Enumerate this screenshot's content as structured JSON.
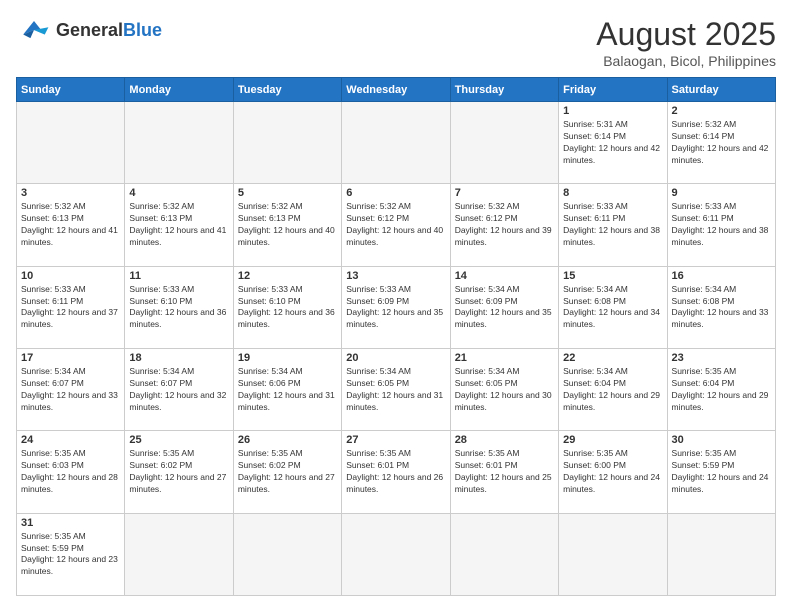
{
  "header": {
    "logo_general": "General",
    "logo_blue": "Blue",
    "month_year": "August 2025",
    "location": "Balaogan, Bicol, Philippines"
  },
  "days_of_week": [
    "Sunday",
    "Monday",
    "Tuesday",
    "Wednesday",
    "Thursday",
    "Friday",
    "Saturday"
  ],
  "weeks": [
    [
      {
        "day": "",
        "empty": true
      },
      {
        "day": "",
        "empty": true
      },
      {
        "day": "",
        "empty": true
      },
      {
        "day": "",
        "empty": true
      },
      {
        "day": "",
        "empty": true
      },
      {
        "day": "1",
        "sunrise": "5:31 AM",
        "sunset": "6:14 PM",
        "daylight": "12 hours and 42 minutes."
      },
      {
        "day": "2",
        "sunrise": "5:32 AM",
        "sunset": "6:14 PM",
        "daylight": "12 hours and 42 minutes."
      }
    ],
    [
      {
        "day": "3",
        "sunrise": "5:32 AM",
        "sunset": "6:13 PM",
        "daylight": "12 hours and 41 minutes."
      },
      {
        "day": "4",
        "sunrise": "5:32 AM",
        "sunset": "6:13 PM",
        "daylight": "12 hours and 41 minutes."
      },
      {
        "day": "5",
        "sunrise": "5:32 AM",
        "sunset": "6:13 PM",
        "daylight": "12 hours and 40 minutes."
      },
      {
        "day": "6",
        "sunrise": "5:32 AM",
        "sunset": "6:12 PM",
        "daylight": "12 hours and 40 minutes."
      },
      {
        "day": "7",
        "sunrise": "5:32 AM",
        "sunset": "6:12 PM",
        "daylight": "12 hours and 39 minutes."
      },
      {
        "day": "8",
        "sunrise": "5:33 AM",
        "sunset": "6:11 PM",
        "daylight": "12 hours and 38 minutes."
      },
      {
        "day": "9",
        "sunrise": "5:33 AM",
        "sunset": "6:11 PM",
        "daylight": "12 hours and 38 minutes."
      }
    ],
    [
      {
        "day": "10",
        "sunrise": "5:33 AM",
        "sunset": "6:11 PM",
        "daylight": "12 hours and 37 minutes."
      },
      {
        "day": "11",
        "sunrise": "5:33 AM",
        "sunset": "6:10 PM",
        "daylight": "12 hours and 36 minutes."
      },
      {
        "day": "12",
        "sunrise": "5:33 AM",
        "sunset": "6:10 PM",
        "daylight": "12 hours and 36 minutes."
      },
      {
        "day": "13",
        "sunrise": "5:33 AM",
        "sunset": "6:09 PM",
        "daylight": "12 hours and 35 minutes."
      },
      {
        "day": "14",
        "sunrise": "5:34 AM",
        "sunset": "6:09 PM",
        "daylight": "12 hours and 35 minutes."
      },
      {
        "day": "15",
        "sunrise": "5:34 AM",
        "sunset": "6:08 PM",
        "daylight": "12 hours and 34 minutes."
      },
      {
        "day": "16",
        "sunrise": "5:34 AM",
        "sunset": "6:08 PM",
        "daylight": "12 hours and 33 minutes."
      }
    ],
    [
      {
        "day": "17",
        "sunrise": "5:34 AM",
        "sunset": "6:07 PM",
        "daylight": "12 hours and 33 minutes."
      },
      {
        "day": "18",
        "sunrise": "5:34 AM",
        "sunset": "6:07 PM",
        "daylight": "12 hours and 32 minutes."
      },
      {
        "day": "19",
        "sunrise": "5:34 AM",
        "sunset": "6:06 PM",
        "daylight": "12 hours and 31 minutes."
      },
      {
        "day": "20",
        "sunrise": "5:34 AM",
        "sunset": "6:05 PM",
        "daylight": "12 hours and 31 minutes."
      },
      {
        "day": "21",
        "sunrise": "5:34 AM",
        "sunset": "6:05 PM",
        "daylight": "12 hours and 30 minutes."
      },
      {
        "day": "22",
        "sunrise": "5:34 AM",
        "sunset": "6:04 PM",
        "daylight": "12 hours and 29 minutes."
      },
      {
        "day": "23",
        "sunrise": "5:35 AM",
        "sunset": "6:04 PM",
        "daylight": "12 hours and 29 minutes."
      }
    ],
    [
      {
        "day": "24",
        "sunrise": "5:35 AM",
        "sunset": "6:03 PM",
        "daylight": "12 hours and 28 minutes."
      },
      {
        "day": "25",
        "sunrise": "5:35 AM",
        "sunset": "6:02 PM",
        "daylight": "12 hours and 27 minutes."
      },
      {
        "day": "26",
        "sunrise": "5:35 AM",
        "sunset": "6:02 PM",
        "daylight": "12 hours and 27 minutes."
      },
      {
        "day": "27",
        "sunrise": "5:35 AM",
        "sunset": "6:01 PM",
        "daylight": "12 hours and 26 minutes."
      },
      {
        "day": "28",
        "sunrise": "5:35 AM",
        "sunset": "6:01 PM",
        "daylight": "12 hours and 25 minutes."
      },
      {
        "day": "29",
        "sunrise": "5:35 AM",
        "sunset": "6:00 PM",
        "daylight": "12 hours and 24 minutes."
      },
      {
        "day": "30",
        "sunrise": "5:35 AM",
        "sunset": "5:59 PM",
        "daylight": "12 hours and 24 minutes."
      }
    ],
    [
      {
        "day": "31",
        "sunrise": "5:35 AM",
        "sunset": "5:59 PM",
        "daylight": "12 hours and 23 minutes."
      },
      {
        "day": "",
        "empty": true
      },
      {
        "day": "",
        "empty": true
      },
      {
        "day": "",
        "empty": true
      },
      {
        "day": "",
        "empty": true
      },
      {
        "day": "",
        "empty": true
      },
      {
        "day": "",
        "empty": true
      }
    ]
  ]
}
